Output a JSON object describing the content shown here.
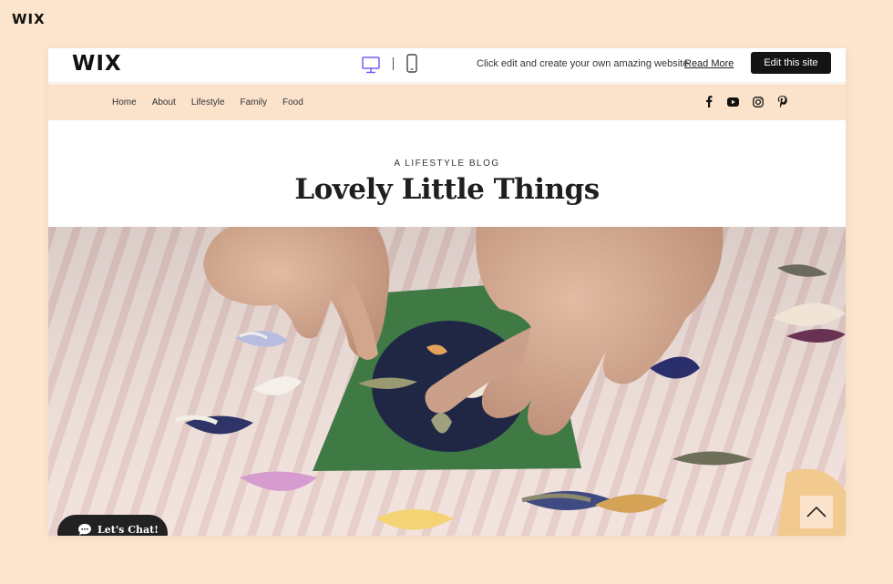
{
  "corner_logo": "WIX",
  "banner": {
    "brand": "WIX",
    "text": "Click edit and create your own amazing website",
    "read_more": "Read More",
    "edit_button": "Edit this site"
  },
  "nav": {
    "items": [
      {
        "label": "Home"
      },
      {
        "label": "About"
      },
      {
        "label": "Lifestyle"
      },
      {
        "label": "Family"
      },
      {
        "label": "Food"
      }
    ],
    "social_icons": [
      "facebook-icon",
      "youtube-icon",
      "instagram-icon",
      "pinterest-icon"
    ]
  },
  "header": {
    "tagline": "A LIFESTYLE BLOG",
    "title": "Lovely Little Things"
  },
  "hero": {
    "image_alt": "hero-image"
  },
  "chat": {
    "label": "Let's Chat!"
  },
  "colors": {
    "page_background": "#fce5cd",
    "nav_background": "#fbe3cb",
    "edit_button": "#141414",
    "device_icon_active": "#7a5cf0",
    "chat_button": "#222222"
  }
}
